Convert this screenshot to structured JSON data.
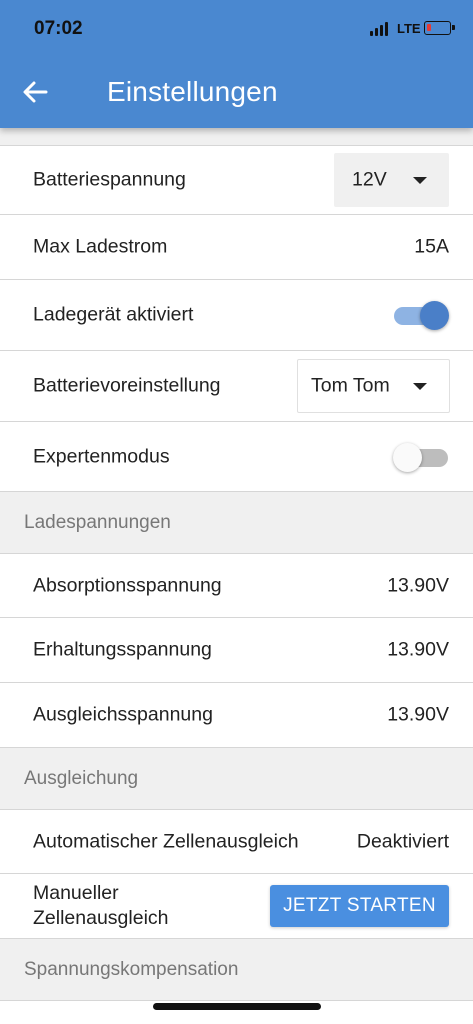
{
  "status_bar": {
    "time": "07:02",
    "network": "LTE",
    "signal_icon": "signal-bars-icon",
    "battery_icon": "battery-low-icon",
    "battery_color": "#e53935"
  },
  "header": {
    "title": "Einstellungen",
    "back_icon": "arrow-left-icon",
    "background_color": "#4a88d0"
  },
  "settings": {
    "battery_voltage": {
      "label": "Batteriespannung",
      "value": "12V"
    },
    "max_current": {
      "label": "Max Ladestrom",
      "value": "15A"
    },
    "charger_enabled": {
      "label": "Ladegerät aktiviert",
      "state": true
    },
    "battery_preset": {
      "label": "Batterievoreinstellung",
      "value": "Tom Tom"
    },
    "expert_mode": {
      "label": "Expertenmodus",
      "state": false
    }
  },
  "charge_voltages": {
    "header": "Ladespannungen",
    "absorption": {
      "label": "Absorptionsspannung",
      "value": "13.90V"
    },
    "float": {
      "label": "Erhaltungsspannung",
      "value": "13.90V"
    },
    "equalization": {
      "label": "Ausgleichsspannung",
      "value": "13.90V"
    }
  },
  "equalizing": {
    "header": "Ausgleichung",
    "auto": {
      "label": "Automatischer Zellenausgleich",
      "value": "Deaktiviert"
    },
    "manual": {
      "label_line1": "Manueller",
      "label_line2": "Zellenausgleich",
      "button": "JETZT STARTEN"
    }
  },
  "compensation": {
    "header": "Spannungskompensation"
  },
  "accent_color": "#4a8fe0"
}
